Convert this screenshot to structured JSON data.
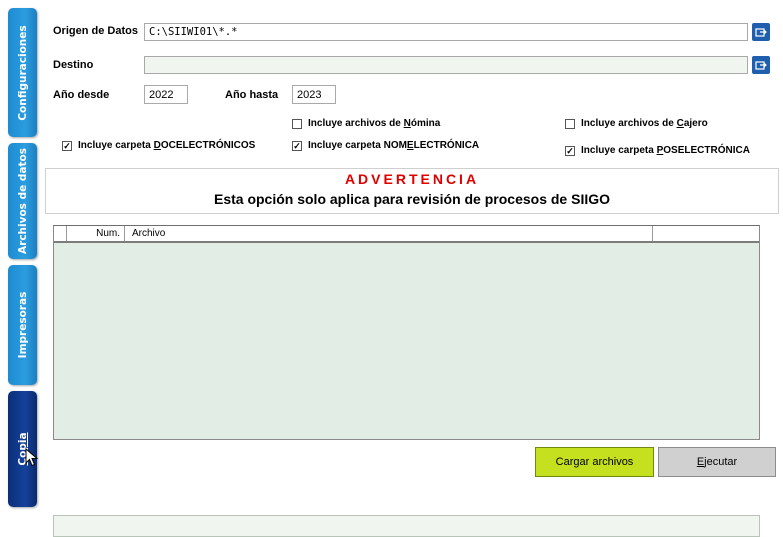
{
  "tabs": [
    {
      "label": "Configuraciones"
    },
    {
      "label": "Archivos de datos"
    },
    {
      "label": "Impresoras"
    },
    {
      "label": "Copia"
    }
  ],
  "form": {
    "origen_label": "Origen de Datos",
    "origen_value": "C:\\SIIWI01\\*.*",
    "destino_label": "Destino",
    "destino_value": "",
    "anio_desde_label": "Año desde",
    "anio_desde_value": "2022",
    "anio_hasta_label": "Año hasta",
    "anio_hasta_value": "2023",
    "browse_icon": "folder-browse-icon"
  },
  "checkboxes": {
    "nomina": {
      "pre": "Incluye archivos de ",
      "ul": "N",
      "post": "ómina",
      "checked": false
    },
    "cajero": {
      "pre": "Incluye archivos de ",
      "ul": "C",
      "post": "ajero",
      "checked": false
    },
    "doc": {
      "pre": "Incluye carpeta ",
      "ul": "D",
      "post": "OCELECTRÓNICOS",
      "checked": true
    },
    "nom": {
      "pre": "Incluye carpeta NOM",
      "ul": "E",
      "post": "LECTRÓNICA",
      "checked": true
    },
    "pos": {
      "pre": "Incluye carpeta ",
      "ul": "P",
      "post": "OSELECTRÓNICA",
      "checked": true
    }
  },
  "warning": {
    "title": "ADVERTENCIA",
    "text": "Esta opción solo aplica para revisión de procesos de SIIGO",
    "title_color": "#e00000"
  },
  "grid": {
    "columns": [
      "Num.",
      "Archivo"
    ],
    "rows": []
  },
  "buttons": {
    "cargar": "Cargar archivos",
    "ejecutar_ul": "E",
    "ejecutar_rest": "jecutar"
  },
  "colors": {
    "tab_blue": "#1d8bd0",
    "tab_navy": "#0b2f7a",
    "cargar_button": "#c4e01e",
    "grid_background": "#e2ede6"
  },
  "pointer": "mouse-cursor-icon"
}
